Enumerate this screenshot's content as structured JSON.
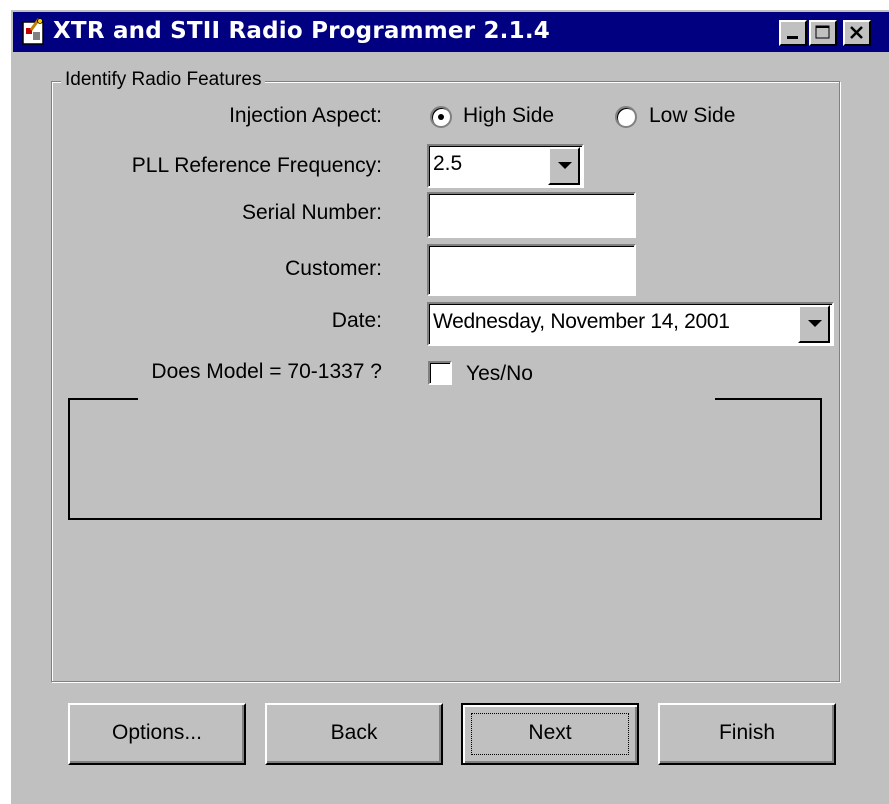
{
  "window": {
    "title": "XTR and STII Radio Programmer 2.1.4",
    "controls": {
      "minimize_icon": "minimize-icon",
      "maximize_icon": "maximize-icon",
      "close_icon": "close-icon"
    }
  },
  "group": {
    "caption": "Identify Radio Features",
    "injection": {
      "label": "Injection Aspect:",
      "options": [
        {
          "label": "High Side",
          "selected": true
        },
        {
          "label": "Low Side",
          "selected": false
        }
      ]
    },
    "pll": {
      "label": "PLL Reference Frequency:",
      "value": "2.5"
    },
    "serial": {
      "label": "Serial Number:",
      "value": ""
    },
    "customer": {
      "label": "Customer:",
      "value": ""
    },
    "date": {
      "label": "Date:",
      "value": "Wednesday, November 14, 2001"
    },
    "model": {
      "label": "Does Model = 70-1337 ?",
      "checkbox_label": "Yes/No",
      "checked": false
    }
  },
  "buttons": {
    "options": "Options...",
    "back": "Back",
    "next": "Next",
    "finish": "Finish"
  },
  "colors": {
    "titlebar": "#000080",
    "face": "#c0c0c0"
  }
}
